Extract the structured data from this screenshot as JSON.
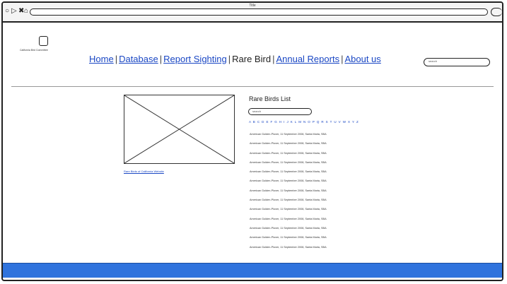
{
  "browser": {
    "title": "Title",
    "nav_icons": [
      "back-icon",
      "forward-icon",
      "close-icon",
      "home-icon"
    ],
    "url": ""
  },
  "site": {
    "logo_text": "California Bird Committee"
  },
  "nav": {
    "items": [
      {
        "label": "Home",
        "current": false
      },
      {
        "label": "Database",
        "current": false
      },
      {
        "label": "Report Sighting",
        "current": false
      },
      {
        "label": "Rare Bird",
        "current": true
      },
      {
        "label": "Annual Reports",
        "current": false
      },
      {
        "label": "About us",
        "current": false
      }
    ],
    "search_placeholder": "search"
  },
  "main": {
    "image_link": "Rare Birds of California Website",
    "list_title": "Rare Birds List",
    "list_search_placeholder": "search",
    "alphabet": "A B C D E F G H I J K L M N O P Q R S T U V W X Y Z",
    "birds": [
      "American Golden-Plover, 11 September 2008, Santa Maria, SBA",
      "American Golden-Plover, 11 September 2008, Santa Maria, SBA",
      "American Golden-Plover, 11 September 2008, Santa Maria, SBA",
      "American Golden-Plover, 11 September 2008, Santa Maria, SBA",
      "American Golden-Plover, 11 September 2008, Santa Maria, SBA",
      "American Golden-Plover, 11 September 2008, Santa Maria, SBA",
      "American Golden-Plover, 11 September 2008, Santa Maria, SBA",
      "American Golden-Plover, 11 September 2008, Santa Maria, SBA",
      "American Golden-Plover, 11 September 2008, Santa Maria, SBA",
      "American Golden-Plover, 11 September 2008, Santa Maria, SBA",
      "American Golden-Plover, 11 September 2008, Santa Maria, SBA",
      "American Golden-Plover, 11 September 2008, Santa Maria, SBA",
      "American Golden-Plover, 11 September 2008, Santa Maria, SBA"
    ]
  },
  "colors": {
    "link": "#1a47c4",
    "footer": "#2f73dd"
  }
}
